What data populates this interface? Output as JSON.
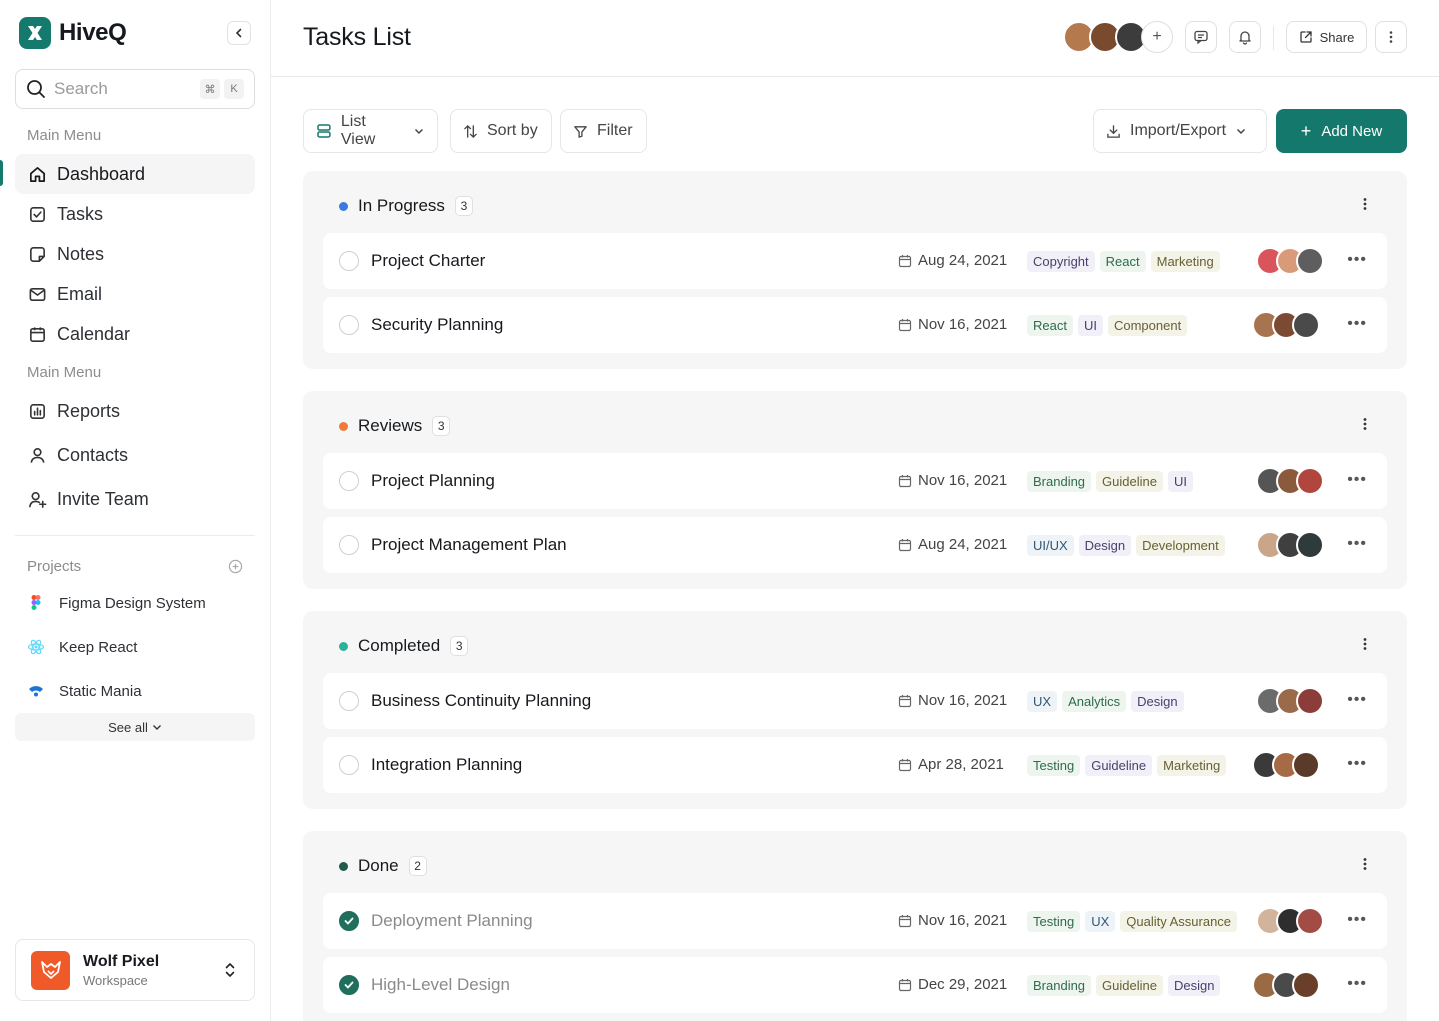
{
  "app": {
    "name": "HiveQ"
  },
  "search": {
    "placeholder": "Search",
    "shortcut_mod": "⌘",
    "shortcut_key": "K"
  },
  "sidebar": {
    "section1_label": "Main Menu",
    "section2_label": "Main Menu",
    "items": [
      {
        "label": "Dashboard",
        "icon": "home-icon",
        "active": true
      },
      {
        "label": "Tasks",
        "icon": "checkbox-icon"
      },
      {
        "label": "Notes",
        "icon": "note-icon"
      },
      {
        "label": "Email",
        "icon": "mail-icon"
      },
      {
        "label": "Calendar",
        "icon": "calendar-icon"
      }
    ],
    "items2": [
      {
        "label": "Reports",
        "icon": "chart-icon"
      },
      {
        "label": "Contacts",
        "icon": "user-icon"
      },
      {
        "label": "Invite Team",
        "icon": "user-plus-icon"
      }
    ],
    "projects_label": "Projects",
    "projects": [
      {
        "label": "Figma Design System",
        "icon": "figma-icon"
      },
      {
        "label": "Keep React",
        "icon": "react-icon"
      },
      {
        "label": "Static Mania",
        "icon": "static-mania-icon"
      }
    ],
    "see_all": "See all"
  },
  "workspace": {
    "name": "Wolf Pixel",
    "sub": "Workspace"
  },
  "header": {
    "title": "Tasks List",
    "share_label": "Share"
  },
  "toolbar": {
    "view_label": "List View",
    "sort_label": "Sort by",
    "filter_label": "Filter",
    "import_label": "Import/Export",
    "add_label": "Add New"
  },
  "colors": {
    "accent": "#15786c",
    "in_progress": "#3b7be0",
    "reviews": "#f07a3a",
    "completed": "#2bb39a",
    "done": "#1f5c4c"
  },
  "groups": [
    {
      "title": "In Progress",
      "count": "3",
      "tasks": [
        {
          "title": "Project Charter",
          "date": "Aug 24, 2021",
          "tags": [
            "Copyright",
            "React",
            "Marketing"
          ],
          "done": false
        },
        {
          "title": "Security Planning",
          "date": "Nov 16, 2021",
          "tags": [
            "React",
            "UI",
            "Component"
          ],
          "done": false
        }
      ]
    },
    {
      "title": "Reviews",
      "count": "3",
      "tasks": [
        {
          "title": "Project Planning",
          "date": "Nov 16, 2021",
          "tags": [
            "Branding",
            "Guideline",
            "UI"
          ],
          "done": false
        },
        {
          "title": "Project Management Plan",
          "date": "Aug 24, 2021",
          "tags": [
            "UI/UX",
            "Design",
            "Development"
          ],
          "done": false
        }
      ]
    },
    {
      "title": "Completed",
      "count": "3",
      "tasks": [
        {
          "title": "Business Continuity Planning",
          "date": "Nov 16, 2021",
          "tags": [
            "UX",
            "Analytics",
            "Design"
          ],
          "done": false
        },
        {
          "title": "Integration Planning",
          "date": "Apr 28, 2021",
          "tags": [
            "Testing",
            "Guideline",
            "Marketing"
          ],
          "done": false
        }
      ]
    },
    {
      "title": "Done",
      "count": "2",
      "tasks": [
        {
          "title": "Deployment Planning",
          "date": "Nov 16, 2021",
          "tags": [
            "Testing",
            "UX",
            "Quality Assurance"
          ],
          "done": true
        },
        {
          "title": "High-Level Design",
          "date": "Dec 29, 2021",
          "tags": [
            "Branding",
            "Guideline",
            "Design"
          ],
          "done": true
        }
      ]
    }
  ]
}
